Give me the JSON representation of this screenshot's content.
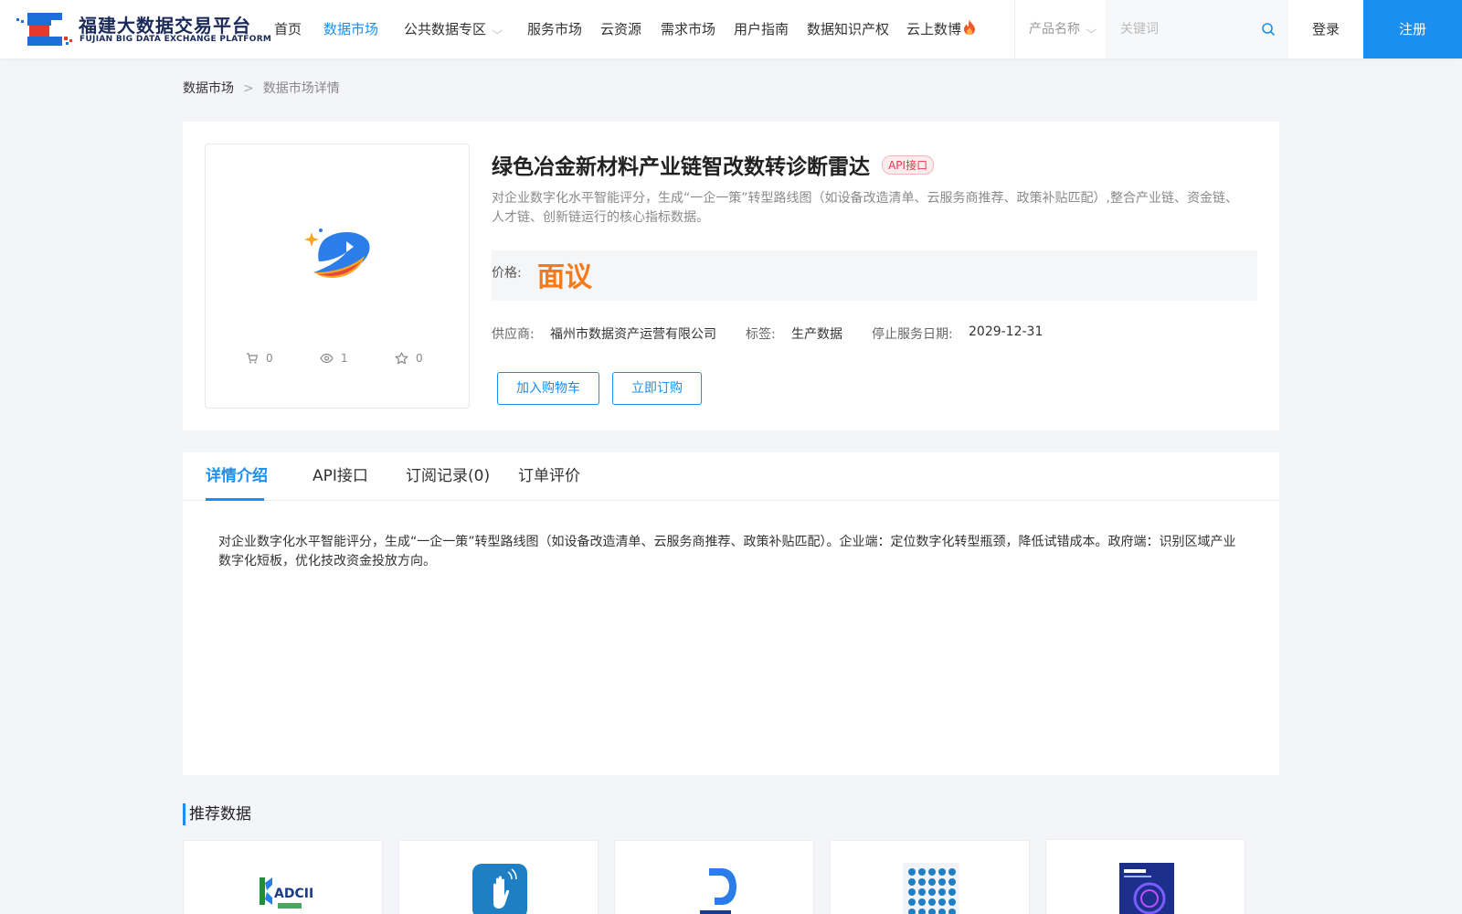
{
  "header": {
    "logo_cn": "福建大数据交易平台",
    "logo_en": "FUJIAN BIG DATA EXCHANGE  PLATFORM",
    "nav": [
      {
        "label": "首页",
        "active": false
      },
      {
        "label": "数据市场",
        "active": true
      },
      {
        "label": "公共数据专区",
        "active": false
      },
      {
        "label": "服务市场",
        "active": false
      },
      {
        "label": "云资源",
        "active": false
      },
      {
        "label": "需求市场",
        "active": false
      },
      {
        "label": "用户指南",
        "active": false
      },
      {
        "label": "数据知识产权",
        "active": false
      },
      {
        "label": "云上数博",
        "active": false
      }
    ],
    "product_select": "产品名称",
    "search_placeholder": "关键词",
    "search_value": "",
    "login_label": "登录",
    "register_label": "注册",
    "accent_color": "#1b8ef2"
  },
  "breadcrumb": {
    "root": "数据市场",
    "separator": ">",
    "current": "数据市场详情"
  },
  "product": {
    "title": "绿色冶金新材料产业链智改数转诊断雷达",
    "badge": "API接口",
    "description": "对企业数字化水平智能评分，生成“一企一策”转型路线图（如设备改造清单、云服务商推荐、政策补贴匹配）,整合产业链、资金链、人才链、创新链运行的核心指标数据。",
    "stats": {
      "cart_count": "0",
      "view_count": "1",
      "favorite_count": "0"
    },
    "price_label": "价格:",
    "price_value": "面议",
    "price_color": "#f57a1c",
    "supplier_label": "供应商:",
    "supplier_value": "福州市数据资产运营有限公司",
    "tag_label": "标签:",
    "tag_value": "生产数据",
    "end_date_label": "停止服务日期:",
    "end_date_value": "2029-12-31",
    "add_cart_label": "加入购物车",
    "subscribe_label": "立即订购"
  },
  "detail": {
    "tabs": [
      {
        "label": "详情介绍",
        "active": true
      },
      {
        "label": "API接口",
        "active": false
      },
      {
        "label": "订阅记录(0)",
        "active": false
      },
      {
        "label": "订单评价",
        "active": false
      }
    ],
    "content": "对企业数字化水平智能评分，生成“一企一策”转型路线图（如设备改造清单、云服务商推荐、政策补贴匹配）。企业端：定位数字化转型瓶颈，降低试错成本。政府端：识别区域产业数字化短板，优化技改资金投放方向。"
  },
  "recommended": {
    "title": "推荐数据",
    "items": [
      {
        "thumb": "adcid-logo"
      },
      {
        "thumb": "hand-app-icon"
      },
      {
        "thumb": "quanzhou-data-logo"
      },
      {
        "thumb": "dot-grid-logo"
      },
      {
        "thumb": "digital-poster"
      }
    ]
  }
}
